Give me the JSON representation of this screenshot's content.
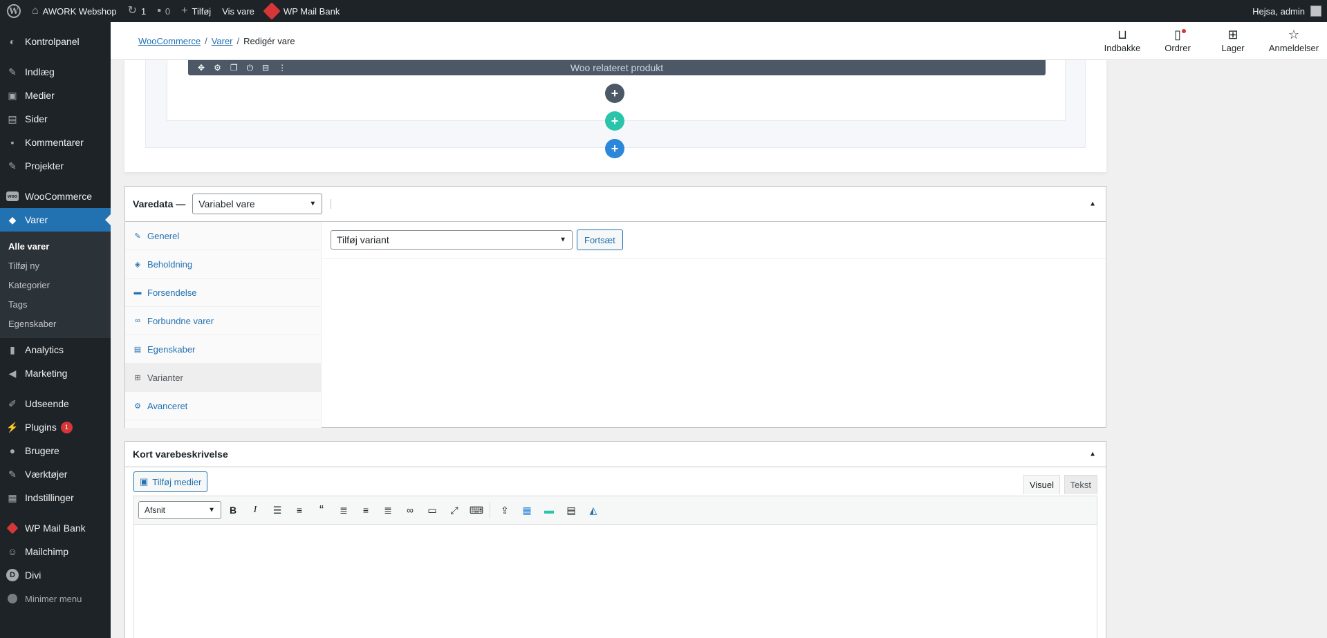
{
  "adminbar": {
    "site_name": "AWORK Webshop",
    "updates_count": "1",
    "comments_count": "0",
    "new_label": "Tilføj",
    "view_label": "Vis vare",
    "mailbank_label": "WP Mail Bank",
    "greeting": "Hejsa, admin"
  },
  "sidebar": {
    "dashboard": "Kontrolpanel",
    "posts": "Indlæg",
    "media": "Medier",
    "pages": "Sider",
    "comments": "Kommentarer",
    "projects": "Projekter",
    "woocommerce": "WooCommerce",
    "products": "Varer",
    "submenu": [
      "Alle varer",
      "Tilføj ny",
      "Kategorier",
      "Tags",
      "Egenskaber"
    ],
    "analytics": "Analytics",
    "marketing": "Marketing",
    "appearance": "Udseende",
    "plugins": "Plugins",
    "plugins_badge": "1",
    "users": "Brugere",
    "tools": "Værktøjer",
    "settings": "Indstillinger",
    "mailbank": "WP Mail Bank",
    "mailchimp": "Mailchimp",
    "divi": "Divi",
    "collapse": "Minimer menu"
  },
  "woo_header": {
    "breadcrumb": [
      "WooCommerce",
      "Varer",
      "Redigér vare"
    ],
    "activity": [
      "Indbakke",
      "Ordrer",
      "Lager",
      "Anmeldelser"
    ]
  },
  "builder": {
    "module_title": "Woo relateret produkt",
    "plus_dark": "+",
    "plus_green": "+",
    "plus_blue": "+"
  },
  "product_data": {
    "title": "Varedata —",
    "type_select": "Variabel vare",
    "tabs": [
      "Generel",
      "Beholdning",
      "Forsendelse",
      "Forbundne varer",
      "Egenskaber",
      "Varianter",
      "Avanceret"
    ],
    "active_tab": "Varianter",
    "add_variation_select": "Tilføj variant",
    "continue_button": "Fortsæt"
  },
  "short_description": {
    "title": "Kort varebeskrivelse",
    "add_media": "Tilføj medier",
    "tab_visual": "Visuel",
    "tab_text": "Tekst",
    "format_select": "Afsnit"
  },
  "colors": {
    "admin_dark": "#1d2327",
    "accent": "#2271b1",
    "badge": "#d63638",
    "divi_green": "#29c4a9",
    "divi_blue": "#2b87da"
  }
}
